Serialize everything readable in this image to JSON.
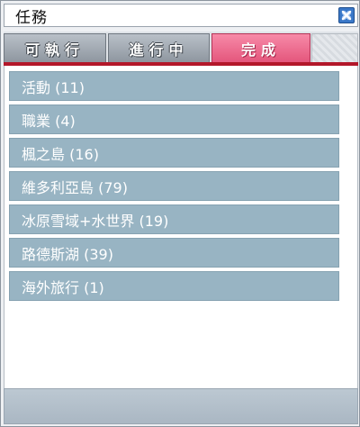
{
  "window": {
    "title": "任務"
  },
  "tabs": [
    {
      "label": "可執行",
      "active": false
    },
    {
      "label": "進行中",
      "active": false
    },
    {
      "label": "完成",
      "active": true
    }
  ],
  "categories": [
    {
      "label": "活動 (11)"
    },
    {
      "label": "職業 (4)"
    },
    {
      "label": "楓之島 (16)"
    },
    {
      "label": "維多利亞島 (79)"
    },
    {
      "label": "冰原雪域+水世界 (19)"
    },
    {
      "label": "路德斯湖 (39)"
    },
    {
      "label": "海外旅行 (1)"
    }
  ],
  "colors": {
    "active_tab": "#e4567c",
    "row_background": "#98b4c3",
    "accent_line": "#b3172a",
    "close_button": "#3a78c8"
  },
  "icons": {
    "close": "close-x-icon"
  }
}
